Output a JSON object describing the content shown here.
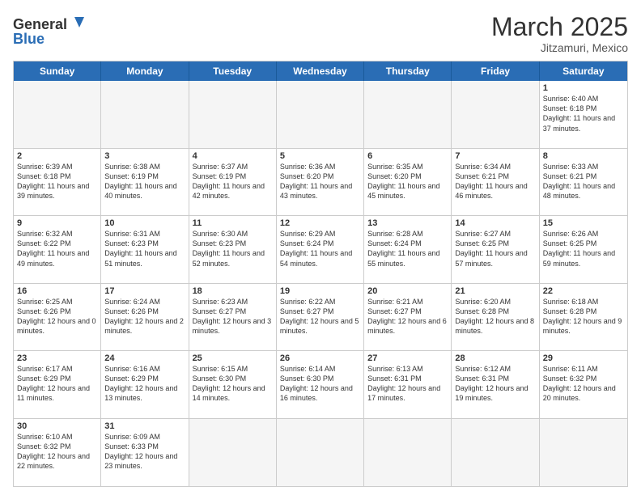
{
  "header": {
    "logo_general": "General",
    "logo_blue": "Blue",
    "month_title": "March 2025",
    "subtitle": "Jitzamuri, Mexico"
  },
  "day_headers": [
    "Sunday",
    "Monday",
    "Tuesday",
    "Wednesday",
    "Thursday",
    "Friday",
    "Saturday"
  ],
  "weeks": [
    [
      {
        "num": "",
        "info": ""
      },
      {
        "num": "",
        "info": ""
      },
      {
        "num": "",
        "info": ""
      },
      {
        "num": "",
        "info": ""
      },
      {
        "num": "",
        "info": ""
      },
      {
        "num": "",
        "info": ""
      },
      {
        "num": "1",
        "info": "Sunrise: 6:40 AM\nSunset: 6:18 PM\nDaylight: 11 hours and 37 minutes."
      }
    ],
    [
      {
        "num": "2",
        "info": "Sunrise: 6:39 AM\nSunset: 6:18 PM\nDaylight: 11 hours and 39 minutes."
      },
      {
        "num": "3",
        "info": "Sunrise: 6:38 AM\nSunset: 6:19 PM\nDaylight: 11 hours and 40 minutes."
      },
      {
        "num": "4",
        "info": "Sunrise: 6:37 AM\nSunset: 6:19 PM\nDaylight: 11 hours and 42 minutes."
      },
      {
        "num": "5",
        "info": "Sunrise: 6:36 AM\nSunset: 6:20 PM\nDaylight: 11 hours and 43 minutes."
      },
      {
        "num": "6",
        "info": "Sunrise: 6:35 AM\nSunset: 6:20 PM\nDaylight: 11 hours and 45 minutes."
      },
      {
        "num": "7",
        "info": "Sunrise: 6:34 AM\nSunset: 6:21 PM\nDaylight: 11 hours and 46 minutes."
      },
      {
        "num": "8",
        "info": "Sunrise: 6:33 AM\nSunset: 6:21 PM\nDaylight: 11 hours and 48 minutes."
      }
    ],
    [
      {
        "num": "9",
        "info": "Sunrise: 6:32 AM\nSunset: 6:22 PM\nDaylight: 11 hours and 49 minutes."
      },
      {
        "num": "10",
        "info": "Sunrise: 6:31 AM\nSunset: 6:23 PM\nDaylight: 11 hours and 51 minutes."
      },
      {
        "num": "11",
        "info": "Sunrise: 6:30 AM\nSunset: 6:23 PM\nDaylight: 11 hours and 52 minutes."
      },
      {
        "num": "12",
        "info": "Sunrise: 6:29 AM\nSunset: 6:24 PM\nDaylight: 11 hours and 54 minutes."
      },
      {
        "num": "13",
        "info": "Sunrise: 6:28 AM\nSunset: 6:24 PM\nDaylight: 11 hours and 55 minutes."
      },
      {
        "num": "14",
        "info": "Sunrise: 6:27 AM\nSunset: 6:25 PM\nDaylight: 11 hours and 57 minutes."
      },
      {
        "num": "15",
        "info": "Sunrise: 6:26 AM\nSunset: 6:25 PM\nDaylight: 11 hours and 59 minutes."
      }
    ],
    [
      {
        "num": "16",
        "info": "Sunrise: 6:25 AM\nSunset: 6:26 PM\nDaylight: 12 hours and 0 minutes."
      },
      {
        "num": "17",
        "info": "Sunrise: 6:24 AM\nSunset: 6:26 PM\nDaylight: 12 hours and 2 minutes."
      },
      {
        "num": "18",
        "info": "Sunrise: 6:23 AM\nSunset: 6:27 PM\nDaylight: 12 hours and 3 minutes."
      },
      {
        "num": "19",
        "info": "Sunrise: 6:22 AM\nSunset: 6:27 PM\nDaylight: 12 hours and 5 minutes."
      },
      {
        "num": "20",
        "info": "Sunrise: 6:21 AM\nSunset: 6:27 PM\nDaylight: 12 hours and 6 minutes."
      },
      {
        "num": "21",
        "info": "Sunrise: 6:20 AM\nSunset: 6:28 PM\nDaylight: 12 hours and 8 minutes."
      },
      {
        "num": "22",
        "info": "Sunrise: 6:18 AM\nSunset: 6:28 PM\nDaylight: 12 hours and 9 minutes."
      }
    ],
    [
      {
        "num": "23",
        "info": "Sunrise: 6:17 AM\nSunset: 6:29 PM\nDaylight: 12 hours and 11 minutes."
      },
      {
        "num": "24",
        "info": "Sunrise: 6:16 AM\nSunset: 6:29 PM\nDaylight: 12 hours and 13 minutes."
      },
      {
        "num": "25",
        "info": "Sunrise: 6:15 AM\nSunset: 6:30 PM\nDaylight: 12 hours and 14 minutes."
      },
      {
        "num": "26",
        "info": "Sunrise: 6:14 AM\nSunset: 6:30 PM\nDaylight: 12 hours and 16 minutes."
      },
      {
        "num": "27",
        "info": "Sunrise: 6:13 AM\nSunset: 6:31 PM\nDaylight: 12 hours and 17 minutes."
      },
      {
        "num": "28",
        "info": "Sunrise: 6:12 AM\nSunset: 6:31 PM\nDaylight: 12 hours and 19 minutes."
      },
      {
        "num": "29",
        "info": "Sunrise: 6:11 AM\nSunset: 6:32 PM\nDaylight: 12 hours and 20 minutes."
      }
    ],
    [
      {
        "num": "30",
        "info": "Sunrise: 6:10 AM\nSunset: 6:32 PM\nDaylight: 12 hours and 22 minutes."
      },
      {
        "num": "31",
        "info": "Sunrise: 6:09 AM\nSunset: 6:33 PM\nDaylight: 12 hours and 23 minutes."
      },
      {
        "num": "",
        "info": ""
      },
      {
        "num": "",
        "info": ""
      },
      {
        "num": "",
        "info": ""
      },
      {
        "num": "",
        "info": ""
      },
      {
        "num": "",
        "info": ""
      }
    ]
  ]
}
